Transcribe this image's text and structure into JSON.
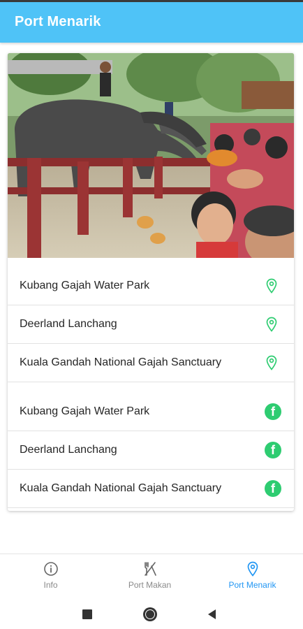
{
  "app_bar": {
    "title": "Port Menarik"
  },
  "locations": [
    {
      "label": "Kubang Gajah Water Park",
      "icon": "location-pin-icon"
    },
    {
      "label": "Deerland Lanchang",
      "icon": "location-pin-icon"
    },
    {
      "label": "Kuala Gandah National Gajah Sanctuary",
      "icon": "location-pin-icon"
    }
  ],
  "facebook": [
    {
      "label": "Kubang Gajah Water Park",
      "icon": "facebook-icon"
    },
    {
      "label": "Deerland Lanchang",
      "icon": "facebook-icon"
    },
    {
      "label": "Kuala Gandah National Gajah Sanctuary",
      "icon": "facebook-icon"
    }
  ],
  "nav": {
    "items": [
      {
        "label": "Info",
        "icon": "info-icon",
        "active": false
      },
      {
        "label": "Port Makan",
        "icon": "fork-knife-icon",
        "active": false
      },
      {
        "label": "Port Menarik",
        "icon": "location-pin-icon",
        "active": true
      }
    ]
  },
  "colors": {
    "app_bar": "#4fc3f7",
    "accent_green": "#2ecc71",
    "active_nav": "#2196f3"
  }
}
